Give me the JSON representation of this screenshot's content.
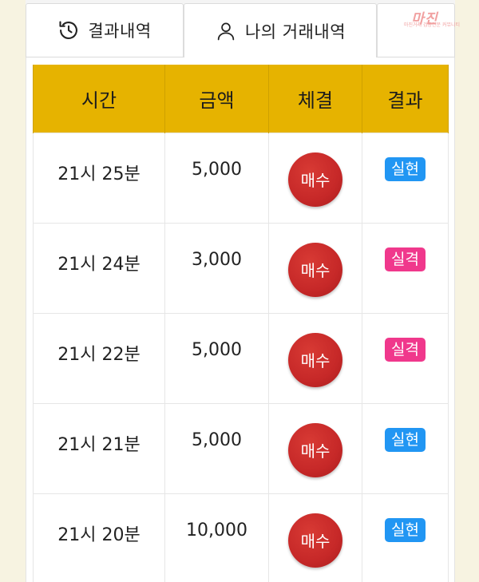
{
  "tabs": [
    {
      "label": "결과내역",
      "icon": "history-icon",
      "active": false
    },
    {
      "label": "나의 거래내역",
      "icon": "user-icon",
      "active": true
    }
  ],
  "watermark": {
    "text": "마진",
    "sub": "마진거래 검증전문 커뮤니티"
  },
  "table": {
    "headers": [
      "시간",
      "금액",
      "체결",
      "결과"
    ],
    "rows": [
      {
        "time": "21시 25분",
        "amount": "5,000",
        "exec": "매수",
        "result": "실현",
        "result_type": "success"
      },
      {
        "time": "21시 24분",
        "amount": "3,000",
        "exec": "매수",
        "result": "실격",
        "result_type": "fail"
      },
      {
        "time": "21시 22분",
        "amount": "5,000",
        "exec": "매수",
        "result": "실격",
        "result_type": "fail"
      },
      {
        "time": "21시 21분",
        "amount": "5,000",
        "exec": "매수",
        "result": "실현",
        "result_type": "success"
      },
      {
        "time": "21시 20분",
        "amount": "10,000",
        "exec": "매수",
        "result": "실현",
        "result_type": "success"
      }
    ]
  },
  "colors": {
    "header_bg": "#e6b300",
    "buy": "#c62828",
    "success": "#2196f3",
    "fail": "#f0388c"
  }
}
